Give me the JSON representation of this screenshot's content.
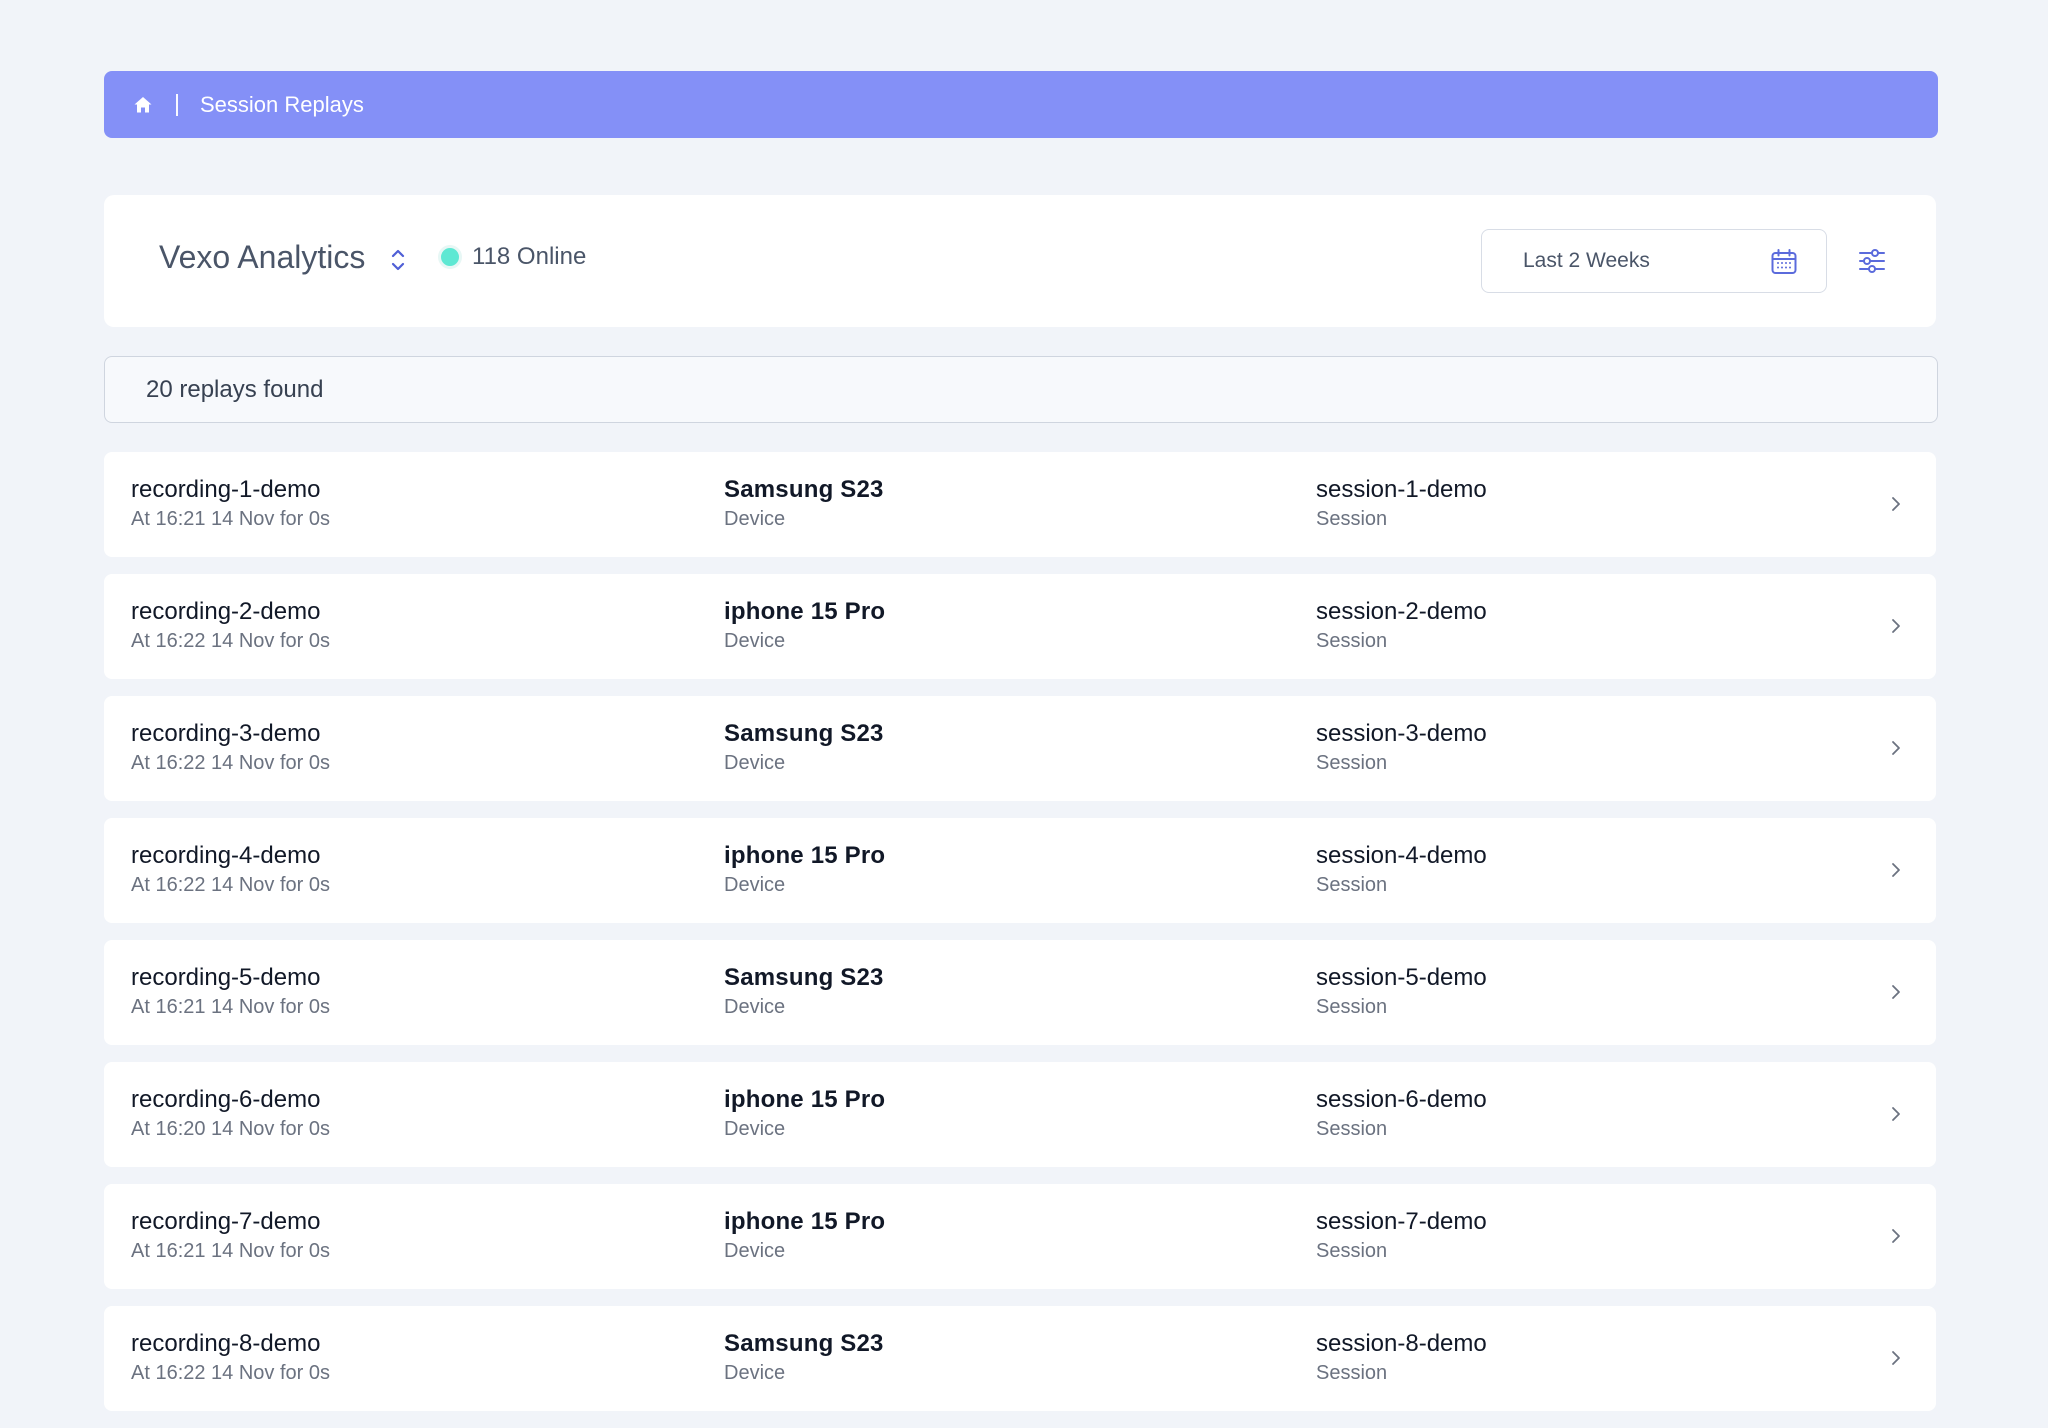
{
  "breadcrumb": {
    "home_icon": "home-icon",
    "current": "Session Replays"
  },
  "header": {
    "app_name": "Vexo Analytics",
    "online_text": "118 Online",
    "date_range": "Last 2 Weeks"
  },
  "results": {
    "count_text": "20 replays found"
  },
  "colors": {
    "breadcrumb_bg": "#8490f7",
    "online_dot": "#5ee8d3",
    "page_bg": "#f1f4f9"
  },
  "replays": [
    {
      "recording": "recording-1-demo",
      "time": "At 16:21 14 Nov for 0s",
      "device": "Samsung S23",
      "device_label": "Device",
      "session": "session-1-demo",
      "session_label": "Session"
    },
    {
      "recording": "recording-2-demo",
      "time": "At 16:22 14 Nov for 0s",
      "device": "iphone 15 Pro",
      "device_label": "Device",
      "session": "session-2-demo",
      "session_label": "Session"
    },
    {
      "recording": "recording-3-demo",
      "time": "At 16:22 14 Nov for 0s",
      "device": "Samsung S23",
      "device_label": "Device",
      "session": "session-3-demo",
      "session_label": "Session"
    },
    {
      "recording": "recording-4-demo",
      "time": "At 16:22 14 Nov for 0s",
      "device": "iphone 15 Pro",
      "device_label": "Device",
      "session": "session-4-demo",
      "session_label": "Session"
    },
    {
      "recording": "recording-5-demo",
      "time": "At 16:21 14 Nov for 0s",
      "device": "Samsung S23",
      "device_label": "Device",
      "session": "session-5-demo",
      "session_label": "Session"
    },
    {
      "recording": "recording-6-demo",
      "time": "At 16:20 14 Nov for 0s",
      "device": "iphone 15 Pro",
      "device_label": "Device",
      "session": "session-6-demo",
      "session_label": "Session"
    },
    {
      "recording": "recording-7-demo",
      "time": "At 16:21 14 Nov for 0s",
      "device": "iphone 15 Pro",
      "device_label": "Device",
      "session": "session-7-demo",
      "session_label": "Session"
    },
    {
      "recording": "recording-8-demo",
      "time": "At 16:22 14 Nov for 0s",
      "device": "Samsung S23",
      "device_label": "Device",
      "session": "session-8-demo",
      "session_label": "Session"
    }
  ]
}
